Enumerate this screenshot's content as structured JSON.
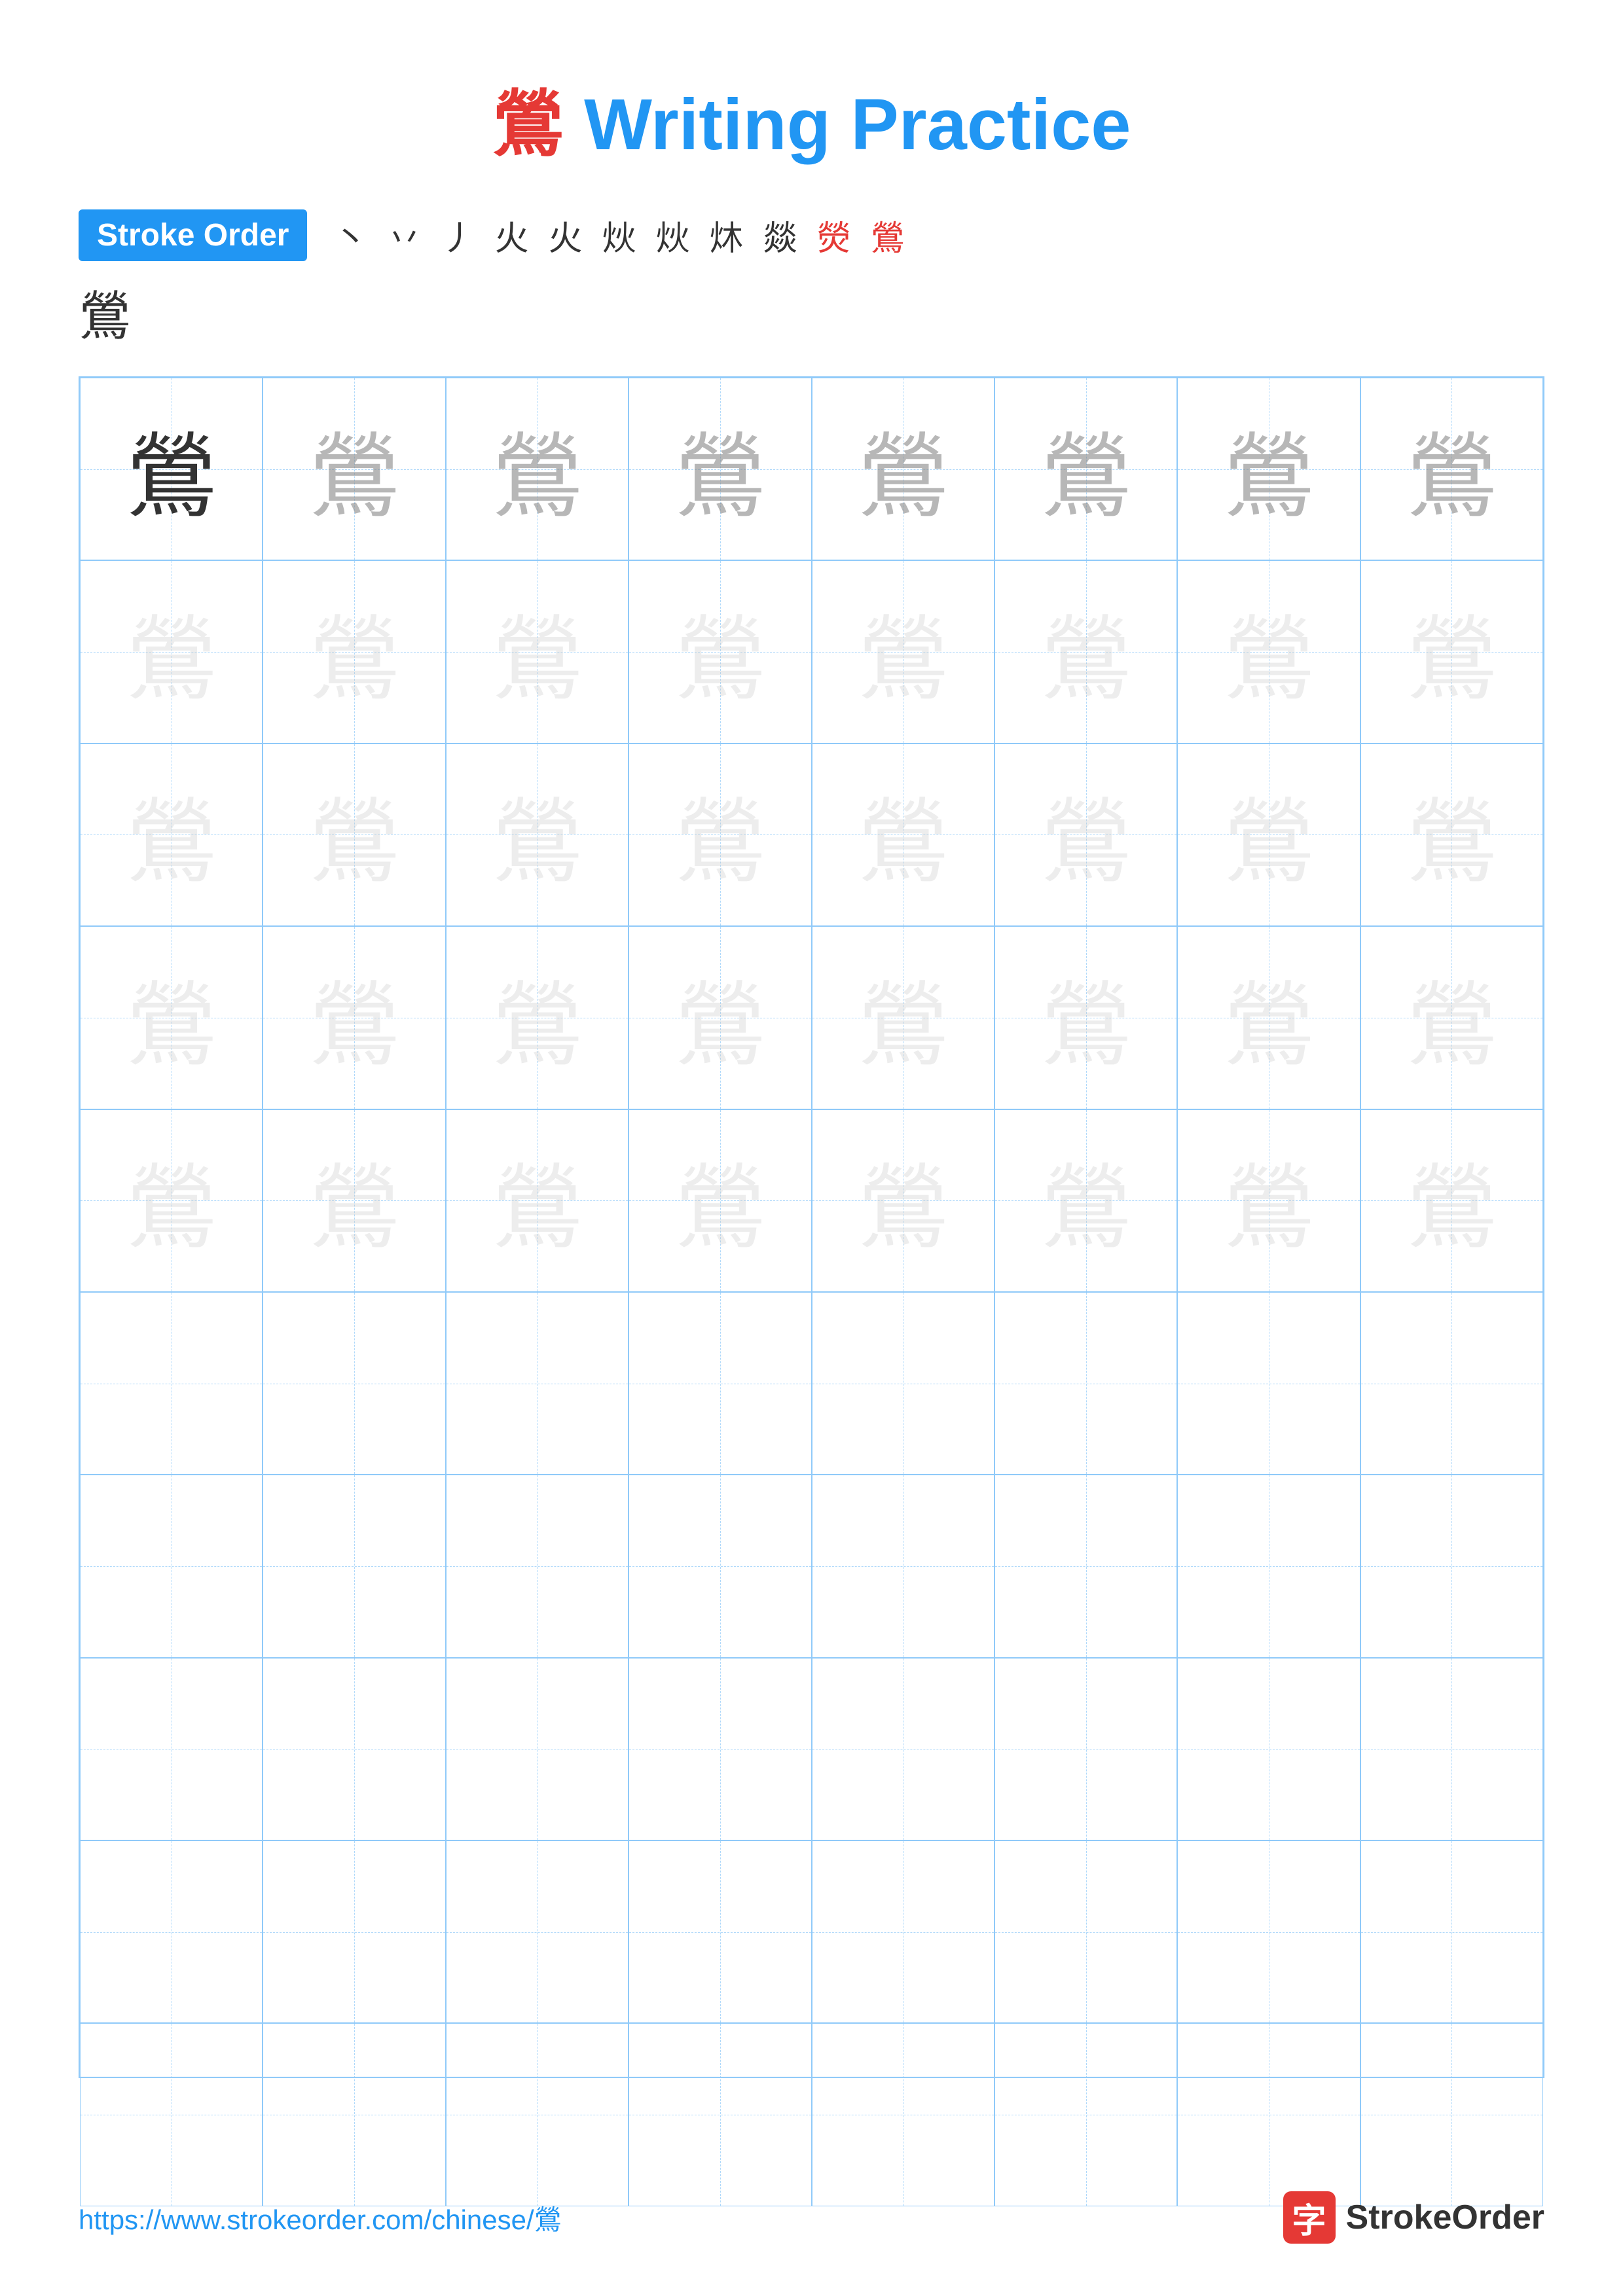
{
  "title": {
    "char": "鶯",
    "label": "Writing Practice",
    "color": "#2196F3",
    "char_color": "#e53935"
  },
  "stroke_order": {
    "badge_label": "Stroke Order",
    "steps": [
      "丶",
      "丷",
      "丿",
      "火",
      "火",
      "炏",
      "炏",
      "炑",
      "燚",
      "熒",
      "熒",
      "鶯"
    ]
  },
  "final_char": "鶯",
  "grid": {
    "rows": 10,
    "cols": 8,
    "character": "鶯",
    "filled_rows": 5
  },
  "footer": {
    "url": "https://www.strokeorder.com/chinese/鶯",
    "logo_char": "字",
    "logo_text": "StrokeOrder"
  }
}
